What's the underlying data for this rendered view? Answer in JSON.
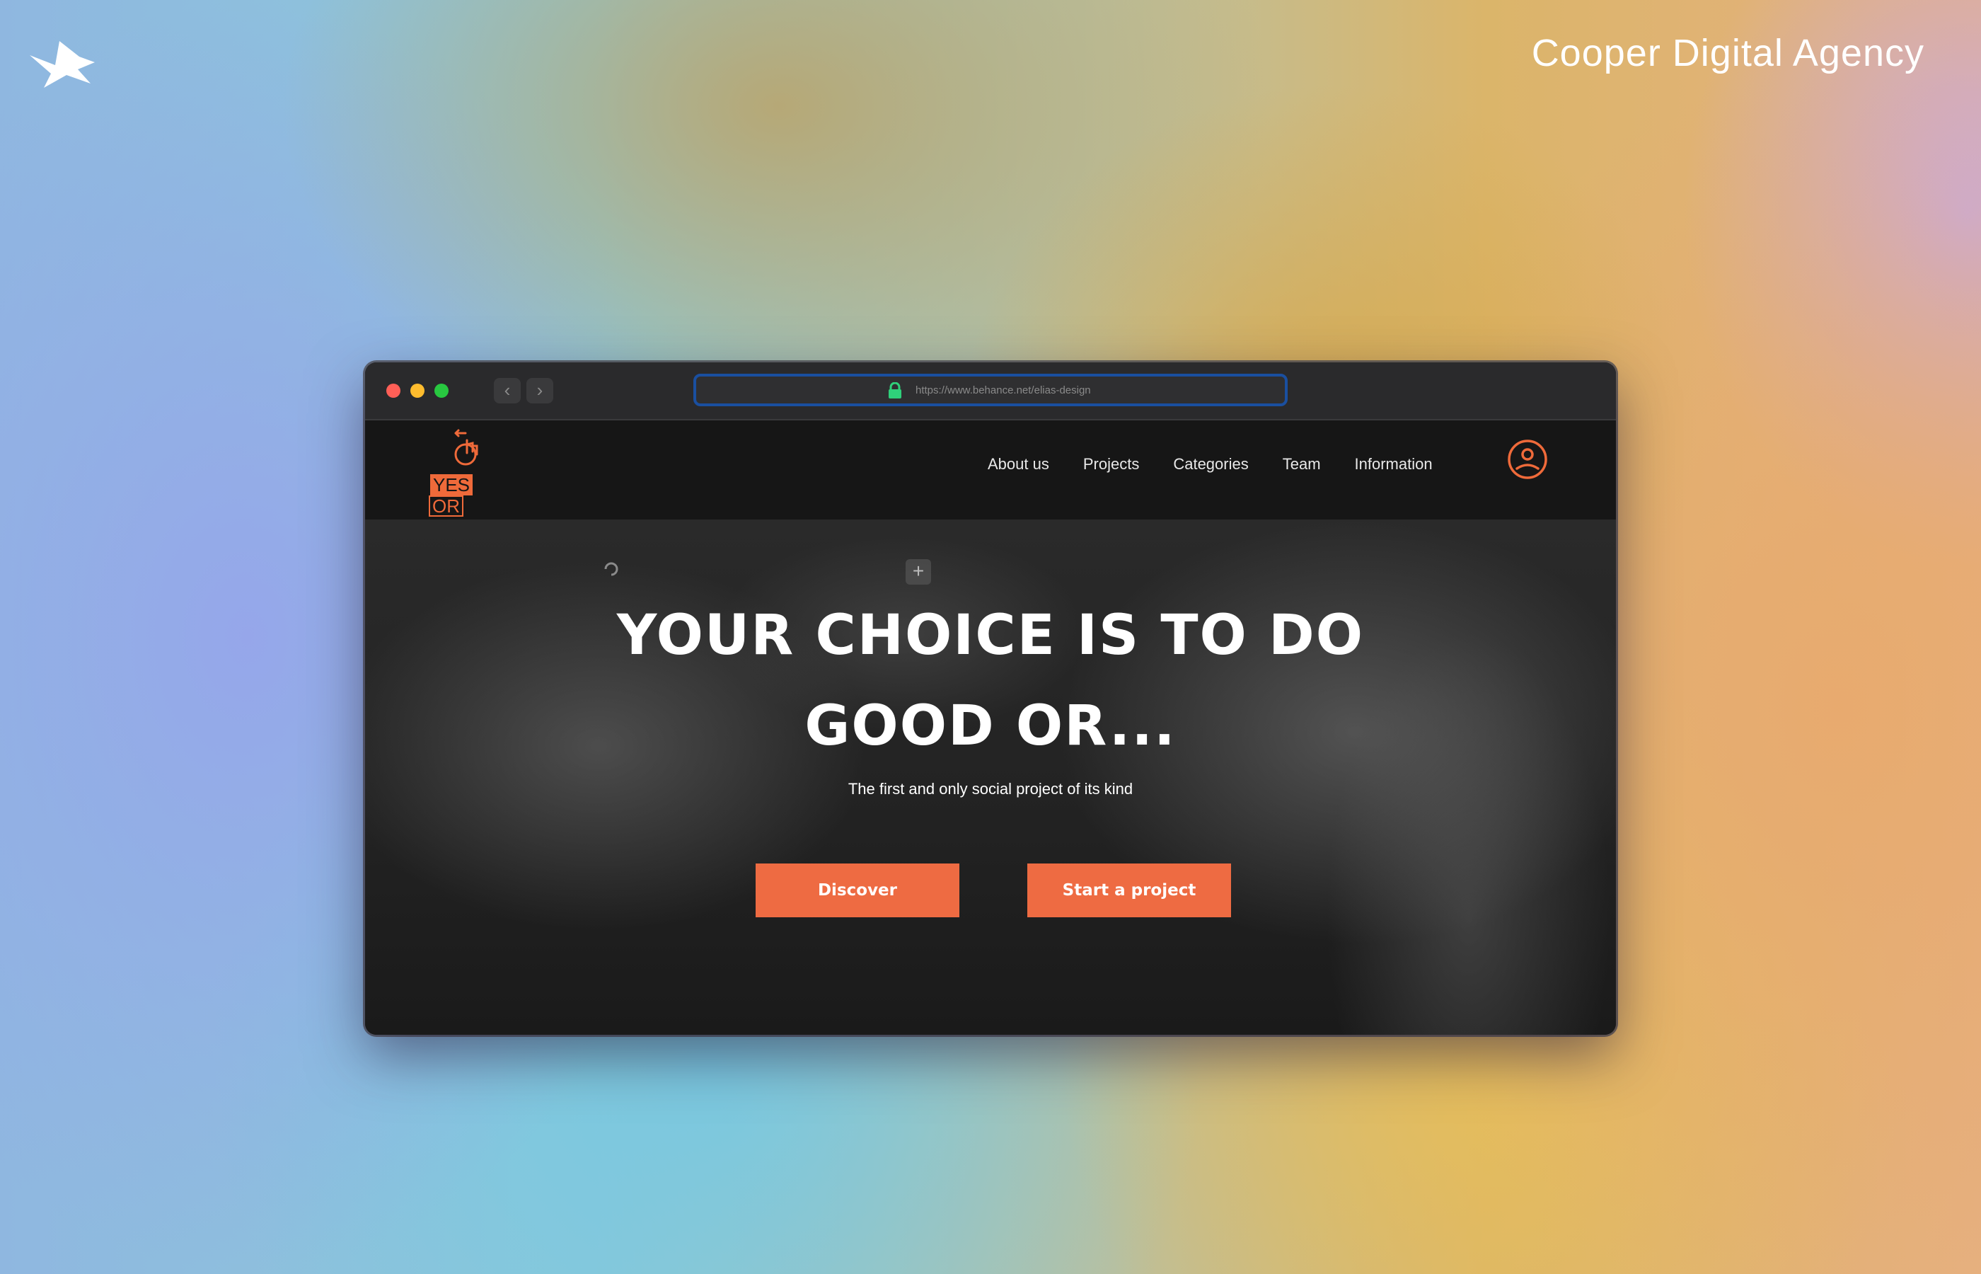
{
  "page": {
    "agency_name": "Cooper Digital Agency",
    "agency_logo_icon": "bird-logo-icon"
  },
  "browser": {
    "traffic_lights": [
      "#ff5f57",
      "#febc2e",
      "#28c840"
    ],
    "back_icon": "chevron-left-icon",
    "forward_icon": "chevron-right-icon",
    "back_glyph": "‹",
    "forward_glyph": "›",
    "lock_icon": "lock-icon",
    "lock_color": "#2fd07a",
    "url": "https://www.behance.net/elias-design",
    "url_border_color": "#1a4fa0"
  },
  "site": {
    "brand": {
      "icon": "pointing-hand-icon",
      "yes": "YES",
      "or": "OR",
      "accent": "#ef6a3a"
    },
    "menu": [
      "About us",
      "Projects",
      "Categories",
      "Team",
      "Information"
    ],
    "profile_icon": "user-circle-icon",
    "hero": {
      "headline_line1": "YOUR CHOICE IS TO DO",
      "headline_line2": "GOOD OR...",
      "subtitle": "The first and only social project of its kind",
      "primary_button": "Discover",
      "secondary_button": "Start a project",
      "button_color": "#ee6b42"
    },
    "ghost_plus": "+"
  }
}
